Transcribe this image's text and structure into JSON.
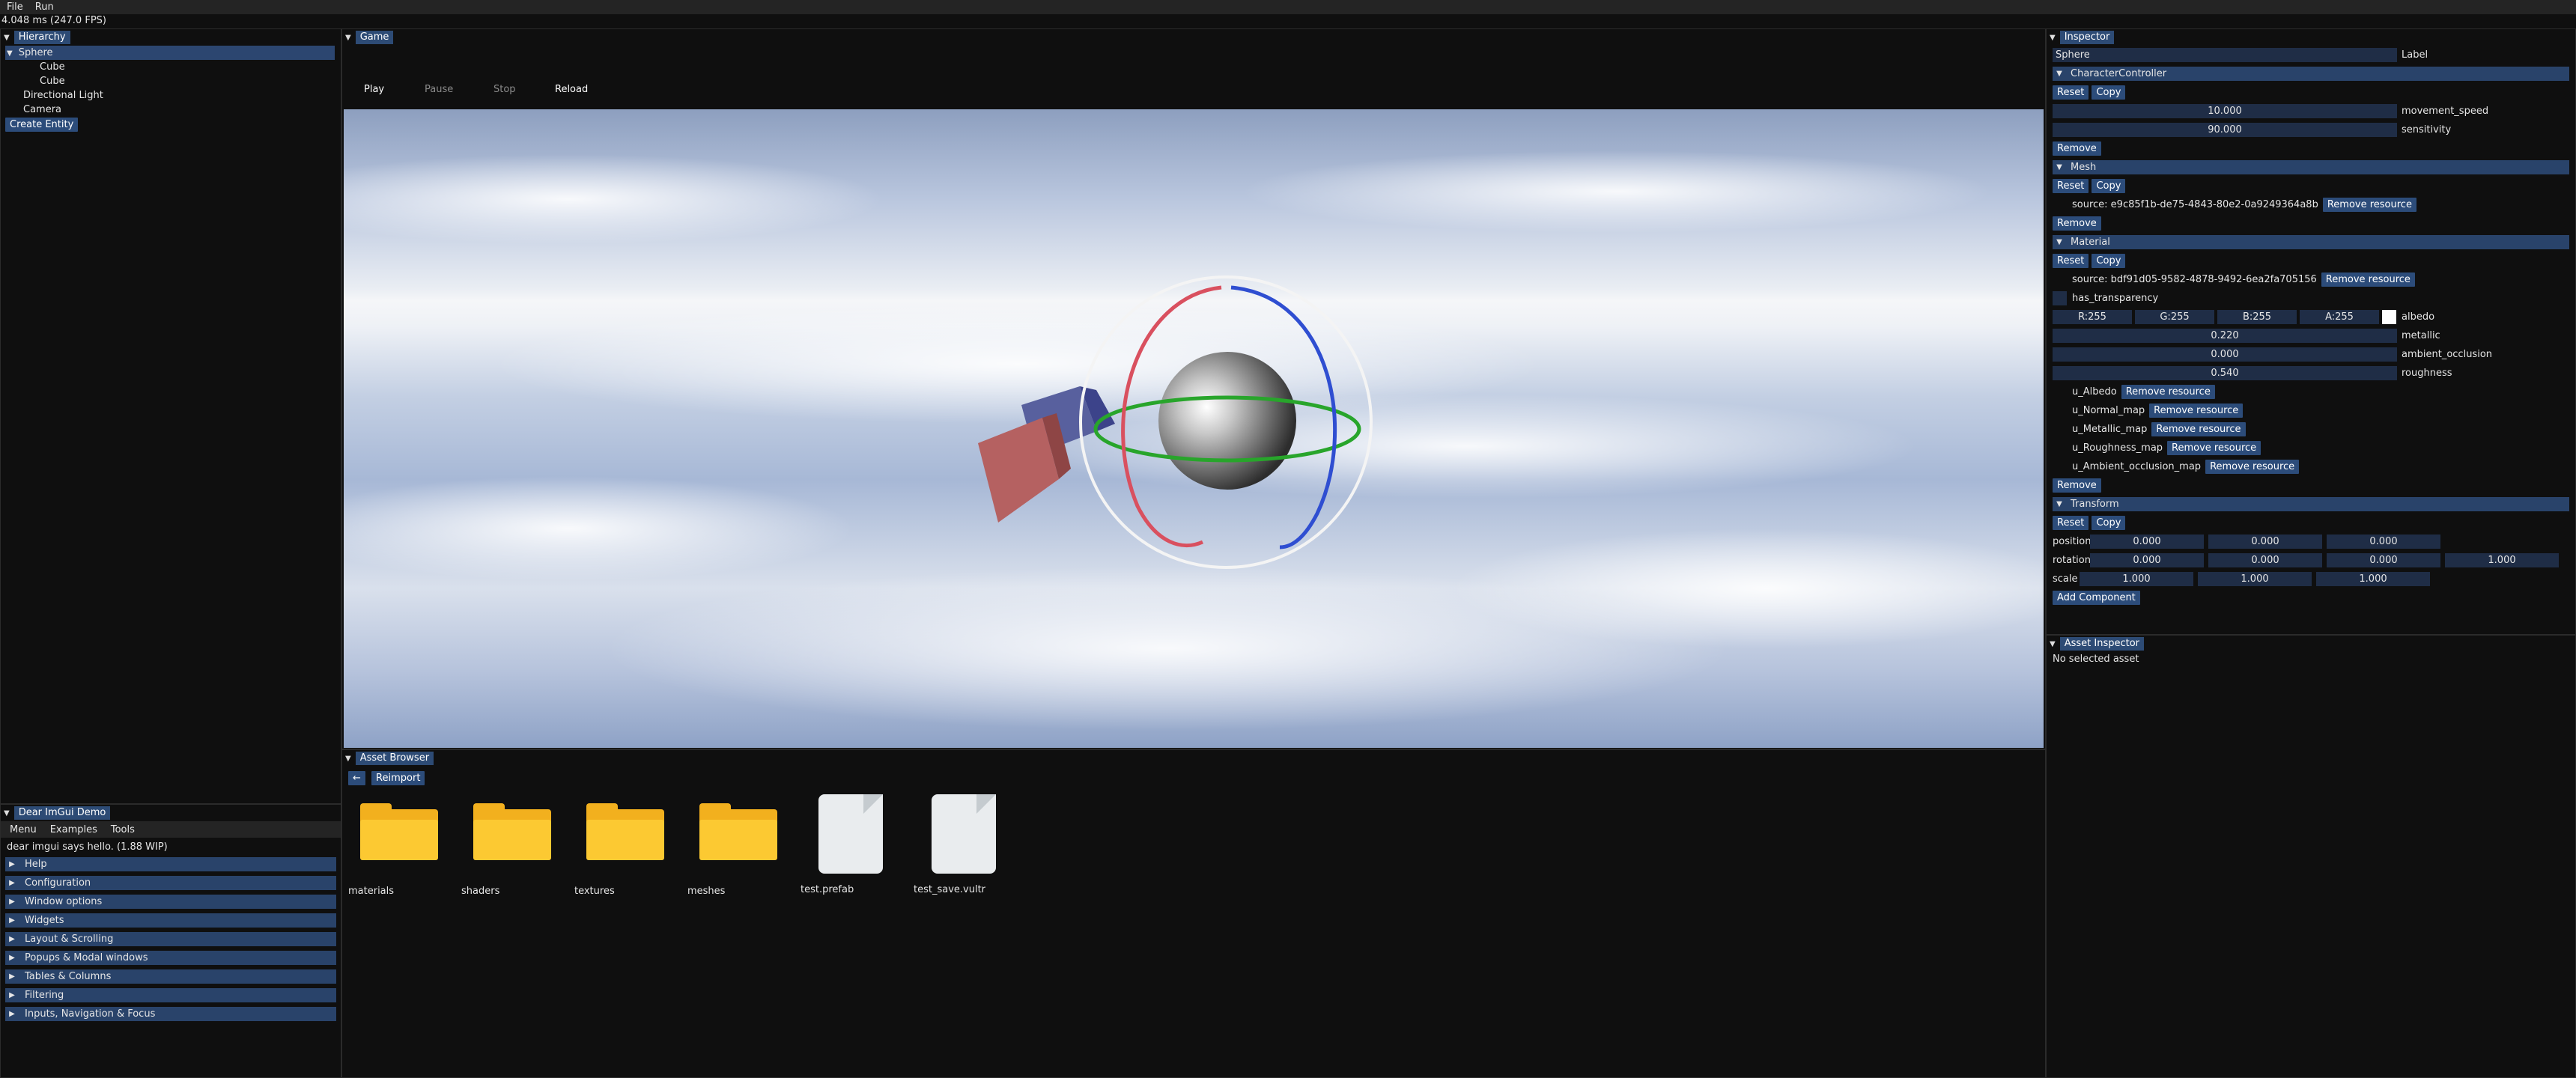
{
  "menu": {
    "file": "File",
    "run": "Run"
  },
  "fps": "4.048 ms (247.0 FPS)",
  "hierarchy": {
    "title": "Hierarchy",
    "items": [
      "Sphere",
      "Cube",
      "Cube",
      "Directional Light",
      "Camera"
    ],
    "create": "Create Entity"
  },
  "game": {
    "title": "Game",
    "play": "Play",
    "pause": "Pause",
    "stop": "Stop",
    "reload": "Reload"
  },
  "inspector": {
    "title": "Inspector",
    "name": "Sphere",
    "name_label": "Label",
    "reset": "Reset",
    "copy": "Copy",
    "remove": "Remove",
    "remove_resource": "Remove resource",
    "cc": {
      "title": "CharacterController",
      "movement_speed": "10.000",
      "movement_speed_label": "movement_speed",
      "sensitivity": "90.000",
      "sensitivity_label": "sensitivity"
    },
    "mesh": {
      "title": "Mesh",
      "source": "source: e9c85f1b-de75-4843-80e2-0a9249364a8b"
    },
    "material": {
      "title": "Material",
      "source": "source: bdf91d05-9582-4878-9492-6ea2fa705156",
      "has_transparency": "has_transparency",
      "r": "R:255",
      "g": "G:255",
      "b": "B:255",
      "a": "A:255",
      "albedo": "albedo",
      "metallic": "0.220",
      "metallic_label": "metallic",
      "ao": "0.000",
      "ao_label": "ambient_occlusion",
      "roughness": "0.540",
      "roughness_label": "roughness",
      "maps": [
        "u_Albedo",
        "u_Normal_map",
        "u_Metallic_map",
        "u_Roughness_map",
        "u_Ambient_occlusion_map"
      ]
    },
    "transform": {
      "title": "Transform",
      "position_label": "position",
      "position": [
        "0.000",
        "0.000",
        "0.000"
      ],
      "rotation_label": "rotation",
      "rotation": [
        "0.000",
        "0.000",
        "0.000",
        "1.000"
      ],
      "scale_label": "scale",
      "scale": [
        "1.000",
        "1.000",
        "1.000"
      ]
    },
    "add_component": "Add Component"
  },
  "asset_inspector": {
    "title": "Asset Inspector",
    "empty": "No selected asset"
  },
  "asset_browser": {
    "title": "Asset Browser",
    "back": "←",
    "reimport": "Reimport",
    "items": [
      {
        "name": "materials",
        "type": "folder"
      },
      {
        "name": "shaders",
        "type": "folder"
      },
      {
        "name": "textures",
        "type": "folder"
      },
      {
        "name": "meshes",
        "type": "folder"
      },
      {
        "name": "test.prefab",
        "type": "file"
      },
      {
        "name": "test_save.vultr",
        "type": "file"
      }
    ]
  },
  "demo": {
    "title": "Dear ImGui Demo",
    "menu": [
      "Menu",
      "Examples",
      "Tools"
    ],
    "hello": "dear imgui says hello. (1.88 WIP)",
    "sections": [
      "Help",
      "Configuration",
      "Window options",
      "Widgets",
      "Layout & Scrolling",
      "Popups & Modal windows",
      "Tables & Columns",
      "Filtering",
      "Inputs, Navigation & Focus"
    ]
  },
  "colors": {
    "accent": "#2c4c7a",
    "header": "#29436a",
    "bg": "#0f0f0f",
    "gizmo_red": "#d9505f",
    "gizmo_blue": "#2f4ed1",
    "gizmo_green": "#28a52b"
  }
}
